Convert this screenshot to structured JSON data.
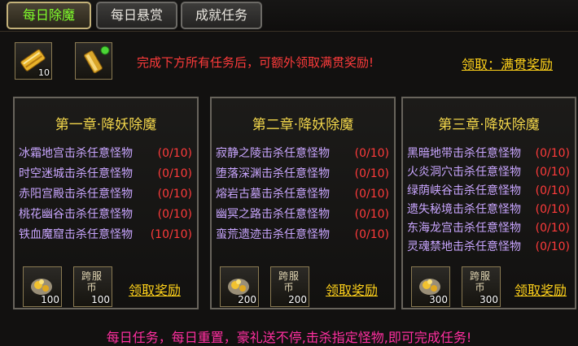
{
  "tabs": [
    {
      "label": "每日除魔",
      "active": true
    },
    {
      "label": "每日悬赏",
      "active": false
    },
    {
      "label": "成就任务",
      "active": false
    }
  ],
  "top_rewards": [
    {
      "icon": "gold-scroll-icon",
      "count": "10"
    },
    {
      "icon": "gold-bar-icon",
      "count": ""
    }
  ],
  "notice": "完成下方所有任务后，可额外领取满贯奖励!",
  "claim_all_label": "领取：满贯奖励",
  "chapters": [
    {
      "title": "第一章·降妖除魔",
      "tasks": [
        {
          "name": "冰霜地宫击杀任意怪物",
          "progress": "(0/10)"
        },
        {
          "name": "时空迷城击杀任意怪物",
          "progress": "(0/10)"
        },
        {
          "name": "赤阳宫殿击杀任意怪物",
          "progress": "(0/10)"
        },
        {
          "name": "桃花幽谷击杀任意怪物",
          "progress": "(0/10)"
        },
        {
          "name": "铁血魔窟击杀任意怪物",
          "progress": "(10/10)"
        }
      ],
      "reward_gold": "100",
      "reward_cross_text": "跨服",
      "reward_cross_sub": "币",
      "reward_cross": "100",
      "claim_label": "领取奖励"
    },
    {
      "title": "第二章·降妖除魔",
      "tasks": [
        {
          "name": "寂静之陵击杀任意怪物",
          "progress": "(0/10)"
        },
        {
          "name": "堕落深渊击杀任意怪物",
          "progress": "(0/10)"
        },
        {
          "name": "熔岩古墓击杀任意怪物",
          "progress": "(0/10)"
        },
        {
          "name": "幽冥之路击杀任意怪物",
          "progress": "(0/10)"
        },
        {
          "name": "蛮荒遗迹击杀任意怪物",
          "progress": "(0/10)"
        }
      ],
      "reward_gold": "200",
      "reward_cross_text": "跨服",
      "reward_cross_sub": "币",
      "reward_cross": "200",
      "claim_label": "领取奖励"
    },
    {
      "title": "第三章·降妖除魔",
      "tasks": [
        {
          "name": "黑暗地带击杀任意怪物",
          "progress": "(0/10)"
        },
        {
          "name": "火炎洞穴击杀任意怪物",
          "progress": "(0/10)"
        },
        {
          "name": "绿荫峡谷击杀任意怪物",
          "progress": "(0/10)"
        },
        {
          "name": "遗失秘境击杀任意怪物",
          "progress": "(0/10)"
        },
        {
          "name": "东海龙宫击杀任意怪物",
          "progress": "(0/10)"
        },
        {
          "name": "灵魂禁地击杀任意怪物",
          "progress": "(0/10)"
        }
      ],
      "reward_gold": "300",
      "reward_cross_text": "跨服",
      "reward_cross_sub": "币",
      "reward_cross": "300",
      "claim_label": "领取奖励"
    }
  ],
  "footer": "每日任务，每日重置，豪礼送不停,击杀指定怪物,即可完成任务!"
}
